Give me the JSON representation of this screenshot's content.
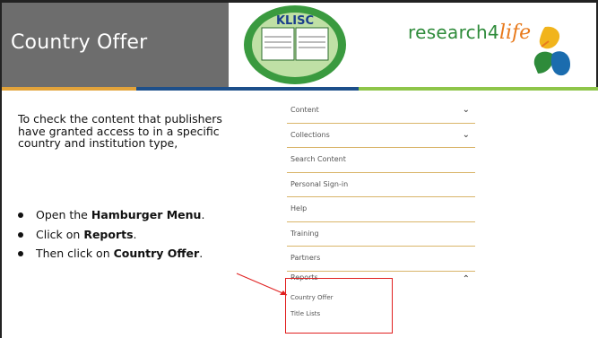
{
  "header": {
    "title": "Country Offer",
    "klisc_logo_text": "KLISC",
    "r4l_prefix": "research4",
    "r4l_life": "life"
  },
  "body": {
    "intro": "To check the content that publishers have granted access to in a specific country and institution type,",
    "bullets": [
      {
        "prefix": "Open the ",
        "bold": "Hamburger Menu",
        "suffix": "."
      },
      {
        "prefix": "Click on ",
        "bold": "Reports",
        "suffix": "."
      },
      {
        "prefix": "Then click on ",
        "bold": "Country Offer",
        "suffix": "."
      }
    ]
  },
  "menu": {
    "items": [
      {
        "label": "Content",
        "chevron": "chevron-down-icon"
      },
      {
        "label": "Collections",
        "chevron": "chevron-down-icon"
      },
      {
        "label": "Search Content"
      },
      {
        "label": "Personal Sign-in"
      },
      {
        "label": "Help"
      },
      {
        "label": "Training"
      },
      {
        "label": "Partners"
      },
      {
        "label": "Reports",
        "chevron": "chevron-up-icon"
      }
    ],
    "sub_items": [
      "Country Offer",
      "Title Lists"
    ]
  },
  "colors": {
    "header_grey": "#6d6d6d",
    "bar_orange": "#e2a33a",
    "bar_blue": "#1d4f8a",
    "bar_green": "#8ec549",
    "highlight_red": "#e02020",
    "r4l_green": "#2e8b3a",
    "r4l_orange": "#e87a1c"
  }
}
